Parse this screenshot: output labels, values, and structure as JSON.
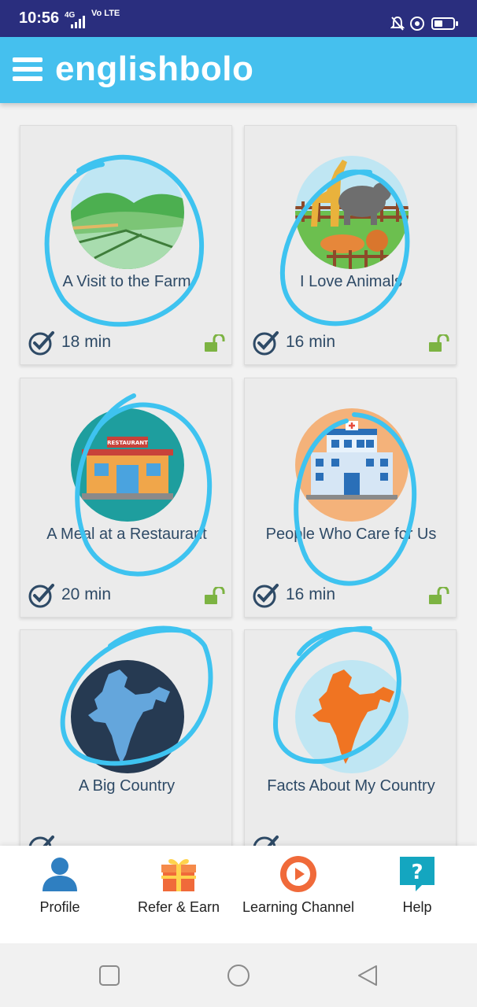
{
  "status_bar": {
    "time": "10:56",
    "network": "4G",
    "volte": "Vo LTE",
    "battery_level": 0.45
  },
  "app_bar": {
    "brand": "englishbolo"
  },
  "lessons": [
    {
      "title": "A Visit to the Farm",
      "duration": "18 min",
      "illustration": "farm-illustration",
      "status": "unlocked"
    },
    {
      "title": "I Love Animals",
      "duration": "16 min",
      "illustration": "animals-illustration",
      "status": "unlocked"
    },
    {
      "title": "A Meal at a Restaurant",
      "duration": "20 min",
      "illustration": "restaurant-illustration",
      "status": "unlocked"
    },
    {
      "title": "People Who Care for Us",
      "duration": "16 min",
      "illustration": "hospital-illustration",
      "status": "unlocked"
    },
    {
      "title": "A Big Country",
      "duration": "",
      "illustration": "india-map-dark-illustration",
      "status": ""
    },
    {
      "title": "Facts About My Country",
      "duration": "",
      "illustration": "india-map-orange-illustration",
      "status": ""
    }
  ],
  "restaurant_sign": "RESTAURANT",
  "bottom_nav": [
    {
      "label": "Profile",
      "icon": "person-icon"
    },
    {
      "label": "Refer & Earn",
      "icon": "gift-icon"
    },
    {
      "label": "Learning Channel",
      "icon": "play-icon"
    },
    {
      "label": "Help",
      "icon": "help-icon"
    }
  ],
  "colors": {
    "status_bar": "#2a2e7e",
    "app_bar": "#45c0ee",
    "annotation_circle": "#3ec3f0",
    "title_text": "#2e4a66",
    "unlock_green": "#7cb342"
  }
}
